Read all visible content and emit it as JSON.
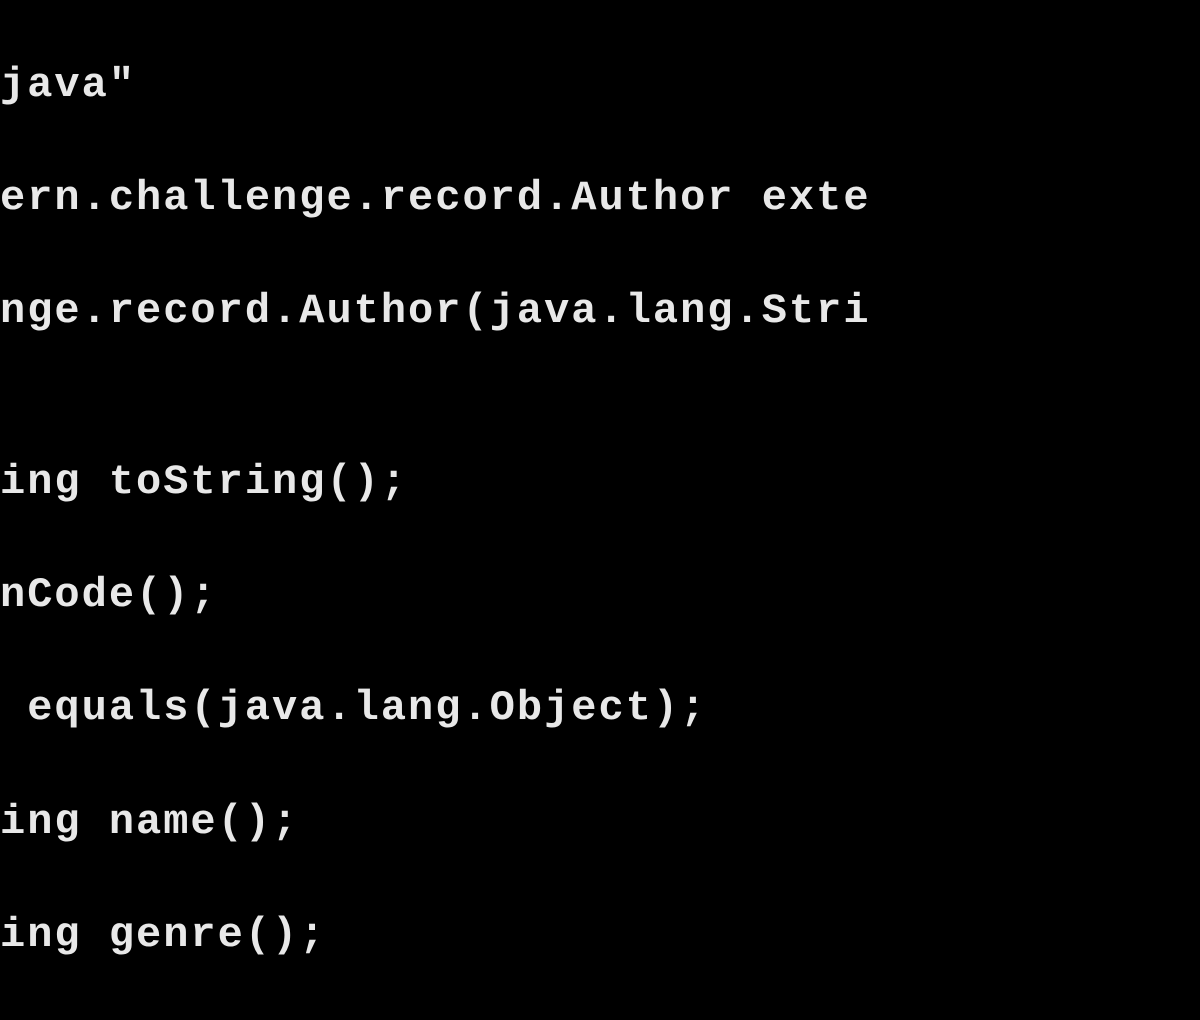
{
  "terminal": {
    "lines": [
      "java\"",
      "ern.challenge.record.Author exte",
      "nge.record.Author(java.lang.Stri",
      "",
      "ing toString();",
      "nCode();",
      " equals(java.lang.Object);",
      "ing name();",
      "ing genre();"
    ]
  }
}
